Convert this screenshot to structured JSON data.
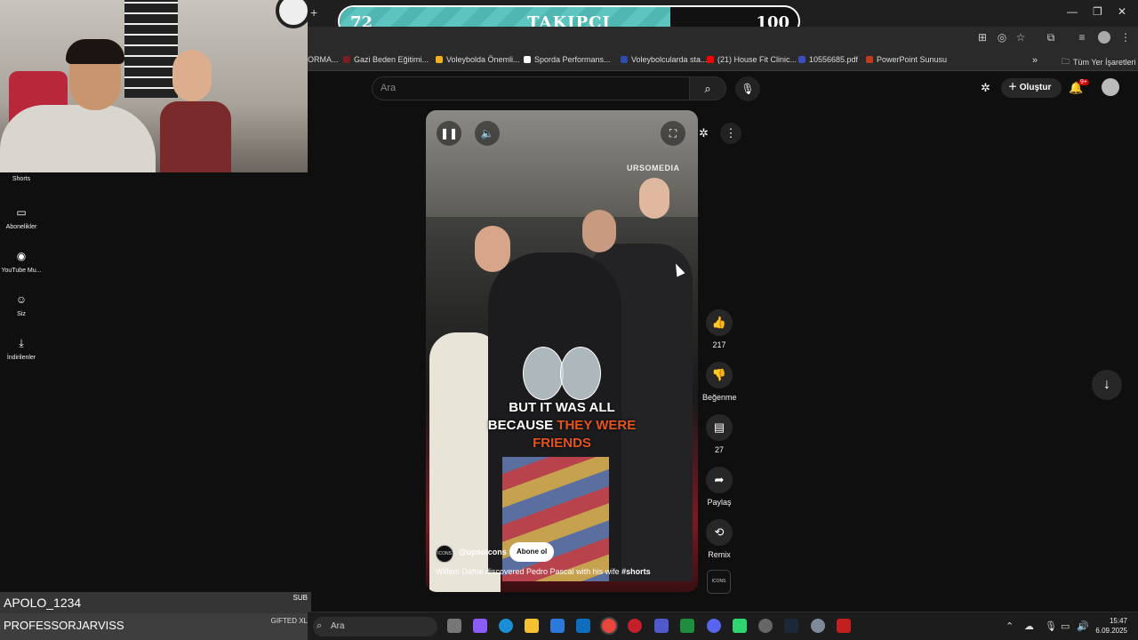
{
  "goal": {
    "current": "72",
    "label": "TAKIPÇI",
    "max": "100",
    "progress_fraction": 0.72,
    "fill_color": "#4fb6b2"
  },
  "bookmarks": [
    {
      "label": "ORMA...",
      "color": "#c23b3b"
    },
    {
      "label": "Gazi Beden Eğitimi...",
      "color": "#7a1f1f"
    },
    {
      "label": "Voleybolda Önemli...",
      "color": "#f2b01e"
    },
    {
      "label": "Sporda Performans...",
      "color": "#ffffff"
    },
    {
      "label": "Voleybolcularda sta...",
      "color": "#2a4ea8"
    },
    {
      "label": "(21) House Fit Clinic...",
      "color": "#ff0000"
    },
    {
      "label": "10556685.pdf",
      "color": "#3a4ec0"
    },
    {
      "label": "PowerPoint Sunusu",
      "color": "#c23b1e"
    }
  ],
  "bookmarks_all": "Tüm Yer İşaretleri",
  "sidebar": {
    "items": [
      {
        "label": "Shorts",
        "icon": "shorts-icon"
      },
      {
        "label": "Abonelikler",
        "icon": "subscriptions-icon"
      },
      {
        "label": "YouTube Mu...",
        "icon": "youtube-music-icon"
      },
      {
        "label": "Siz",
        "icon": "you-icon"
      },
      {
        "label": "İndirilenler",
        "icon": "download-icon"
      }
    ]
  },
  "header": {
    "search_placeholder": "Ara",
    "create_label": "Oluştur",
    "notif_badge": "9+"
  },
  "video": {
    "watermark": "URSOMEDIA",
    "caption_line1": "BUT IT WAS ALL",
    "caption_line2_white": "BECAUSE",
    "caption_line2_highlight": "THEY WERE",
    "caption_line3_highlight": "FRIENDS",
    "channel": "@upsoicons",
    "channel_avatar_text": "ICONS",
    "subscribe_label": "Abone ol",
    "title_text": "Willem Dafoe discovered Pedro Pascal with his wife",
    "title_hashtag": "#shorts"
  },
  "actions": {
    "like_count": "217",
    "dislike_label": "Beğenme",
    "comment_count": "27",
    "share_label": "Paylaş",
    "remix_label": "Remix",
    "sound_thumb_text": "ICONS"
  },
  "chat": [
    {
      "name": "APOLO_1234",
      "tag": "SUB"
    },
    {
      "name": "PROFESSORJARVISS",
      "tag": "GIFTED XL"
    }
  ],
  "taskbar": {
    "search_placeholder": "Ara",
    "time": "15:47",
    "date": "6.09.2025"
  }
}
